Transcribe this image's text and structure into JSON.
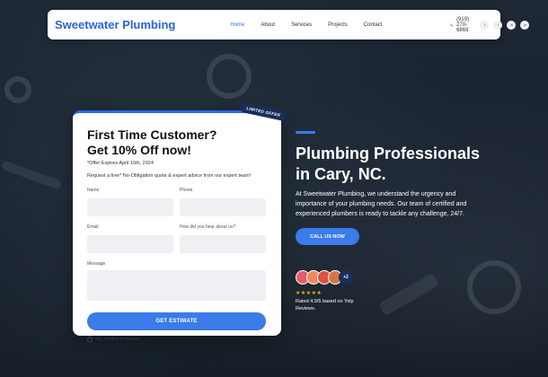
{
  "nav": {
    "logo": "Sweetwater Plumbing",
    "links": [
      "Home",
      "About",
      "Services",
      "Projects",
      "Contact"
    ],
    "active_index": 0,
    "phone": "(919) 270-6869",
    "socials": [
      "f",
      "t",
      "in",
      "yt"
    ],
    "social_icons": [
      "facebook-icon",
      "twitter-icon",
      "instagram-icon",
      "youtube-icon"
    ]
  },
  "form": {
    "badge": "LIMITED OFFER",
    "title_line1": "First Time Customer?",
    "title_line2": "Get 10% Off now!",
    "offer_expiry": "*Offer Expires April 16th, 2024",
    "subtitle": "Request a free* No-Obligation quote & expert advice from our expert team!",
    "name_label": "Name",
    "phone_label": "Phone",
    "email_label": "Email",
    "source_label": "How did you hear about us?",
    "message_label": "Message",
    "name_value": "",
    "phone_value": "",
    "email_value": "",
    "source_value": "",
    "message_value": "",
    "submit_label": "GET ESTIMATE",
    "ssl_text": "SSL Certified & Secured"
  },
  "hero": {
    "title_line1": "Plumbing Professionals",
    "title_line2": "in Cary, NC.",
    "description": "At Sweetwater Plumbing, we understand the urgency and importance of your plumbing needs. Our team of certified and experienced plumbers is ready to tackle any challenge, 24/7.",
    "cta_label": "CALL US NOW",
    "avatar_more": "+2",
    "stars": "★★★★★",
    "rating_text": "Rated 4.9/5 based on Yelp Reviews."
  },
  "colors": {
    "brand": "#2c63d6",
    "accent": "#3b7bea",
    "badge": "#1a2e5c",
    "star": "#f5b50a",
    "avatar_colors": [
      "#e35d6a",
      "#f08a5d",
      "#e0503f",
      "#d8744a"
    ]
  }
}
